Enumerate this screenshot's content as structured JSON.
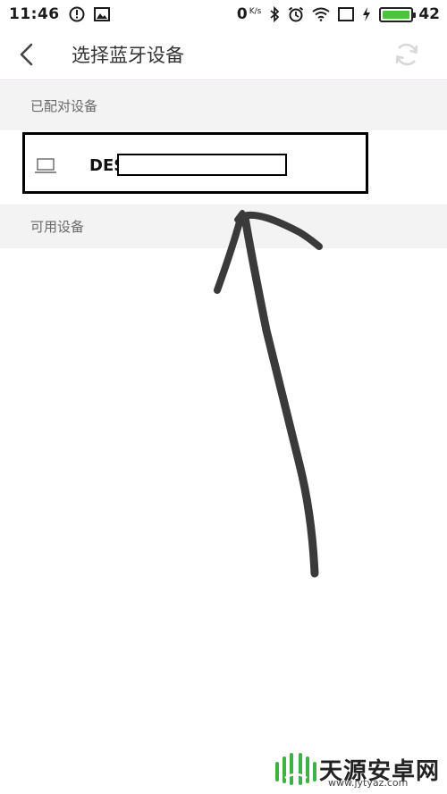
{
  "status_bar": {
    "time": "11:46",
    "net_speed": "0",
    "net_unit": "K/s",
    "battery": "42",
    "battery_level": 0.42,
    "icons": [
      "alert-circle-icon",
      "image-icon",
      "bluetooth-icon",
      "alarm-icon",
      "wifi-icon",
      "square-icon",
      "charging-icon"
    ]
  },
  "header": {
    "title": "选择蓝牙设备"
  },
  "sections": {
    "paired_label": "已配对设备",
    "available_label": "可用设备"
  },
  "paired_devices": [
    {
      "name": "DES",
      "icon": "laptop-icon"
    }
  ],
  "watermark": {
    "text": "天源安卓网",
    "url": "www.jytyaz.com"
  },
  "colors": {
    "section_bg": "#f3f3f3",
    "battery_green": "#4cc23f",
    "arrow": "#3a3a3a"
  }
}
